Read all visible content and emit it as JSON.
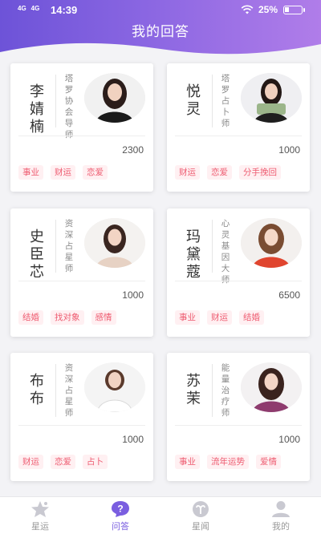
{
  "status_bar": {
    "signal1": "4G",
    "signal2": "4G",
    "time": "14:39",
    "battery": "25%"
  },
  "header": {
    "title": "我的回答"
  },
  "cards": [
    {
      "name": "李婧楠",
      "title": "塔罗协会导师",
      "count": "2300",
      "tags": [
        "事业",
        "财运",
        "恋爱"
      ]
    },
    {
      "name": "悦灵",
      "title": "塔罗占卜师",
      "count": "1000",
      "tags": [
        "财运",
        "恋爱",
        "分手挽回"
      ]
    },
    {
      "name": "史臣芯",
      "title": "资深占星师",
      "count": "1000",
      "tags": [
        "结婚",
        "找对象",
        "感情"
      ]
    },
    {
      "name": "玛黛蔻",
      "title": "心灵基因大师",
      "count": "6500",
      "tags": [
        "事业",
        "财运",
        "结婚"
      ]
    },
    {
      "name": "布布",
      "title": "资深占星师",
      "count": "1000",
      "tags": [
        "财运",
        "恋爱",
        "占卜"
      ]
    },
    {
      "name": "苏茉",
      "title": "能量治疗师",
      "count": "1000",
      "tags": [
        "事业",
        "流年运势",
        "爱情"
      ]
    }
  ],
  "tabbar": {
    "tabs": [
      {
        "label": "星运",
        "icon": "star-icon",
        "active": false
      },
      {
        "label": "问答",
        "icon": "question-bubble-icon",
        "active": true
      },
      {
        "label": "星闻",
        "icon": "aries-icon",
        "active": false
      },
      {
        "label": "我的",
        "icon": "user-icon",
        "active": false
      }
    ]
  },
  "colors": {
    "header_start": "#6d53d8",
    "header_end": "#b07de9",
    "tag_text": "#ee5b70",
    "tag_bg": "#fff0f2",
    "active_tab": "#7a5ee0"
  }
}
